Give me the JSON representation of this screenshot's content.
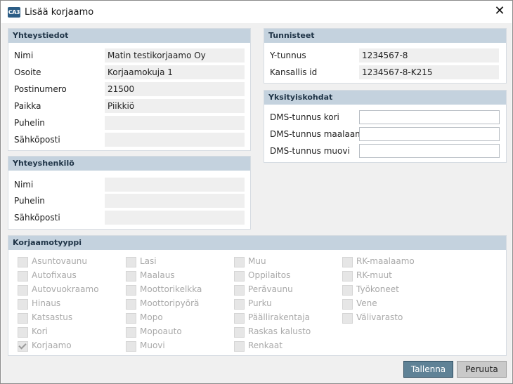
{
  "window": {
    "title": "Lisää korjaamo",
    "icon_text": "CA3",
    "close_glyph": "✕"
  },
  "contact": {
    "header": "Yhteystiedot",
    "fields": [
      {
        "label": "Nimi",
        "value": "Matin testikorjaamo Oy"
      },
      {
        "label": "Osoite",
        "value": "Korjaamokuja 1"
      },
      {
        "label": "Postinumero",
        "value": "21500"
      },
      {
        "label": "Paikka",
        "value": "Piikkiö"
      },
      {
        "label": "Puhelin",
        "value": ""
      },
      {
        "label": "Sähköposti",
        "value": ""
      }
    ]
  },
  "contact_person": {
    "header": "Yhteyshenkilö",
    "fields": [
      {
        "label": "Nimi",
        "value": ""
      },
      {
        "label": "Puhelin",
        "value": ""
      },
      {
        "label": "Sähköposti",
        "value": ""
      }
    ]
  },
  "identifiers": {
    "header": "Tunnisteet",
    "fields": [
      {
        "label": "Y-tunnus",
        "value": "1234567-8"
      },
      {
        "label": "Kansallis id",
        "value": "1234567-8-K215"
      }
    ]
  },
  "details": {
    "header": "Yksityiskohdat",
    "fields": [
      {
        "label": "DMS-tunnus kori",
        "value": ""
      },
      {
        "label": "DMS-tunnus maalaamo",
        "value": ""
      },
      {
        "label": "DMS-tunnus muovi",
        "value": ""
      }
    ]
  },
  "repair_types": {
    "header": "Korjaamotyyppi",
    "columns": [
      [
        {
          "label": "Asuntovaunu",
          "checked": false
        },
        {
          "label": "Autofixaus",
          "checked": false
        },
        {
          "label": "Autovuokraamo",
          "checked": false
        },
        {
          "label": "Hinaus",
          "checked": false
        },
        {
          "label": "Katsastus",
          "checked": false
        },
        {
          "label": "Kori",
          "checked": false
        },
        {
          "label": "Korjaamo",
          "checked": true
        }
      ],
      [
        {
          "label": "Lasi",
          "checked": false
        },
        {
          "label": "Maalaus",
          "checked": false
        },
        {
          "label": "Moottorikelkka",
          "checked": false
        },
        {
          "label": "Moottoripyörä",
          "checked": false
        },
        {
          "label": "Mopo",
          "checked": false
        },
        {
          "label": "Mopoauto",
          "checked": false
        },
        {
          "label": "Muovi",
          "checked": false
        }
      ],
      [
        {
          "label": "Muu",
          "checked": false
        },
        {
          "label": "Oppilaitos",
          "checked": false
        },
        {
          "label": "Perävaunu",
          "checked": false
        },
        {
          "label": "Purku",
          "checked": false
        },
        {
          "label": "Päällirakentaja",
          "checked": false
        },
        {
          "label": "Raskas kalusto",
          "checked": false
        },
        {
          "label": "Renkaat",
          "checked": false
        }
      ],
      [
        {
          "label": "RK-maalaamo",
          "checked": false
        },
        {
          "label": "RK-muut",
          "checked": false
        },
        {
          "label": "Työkoneet",
          "checked": false
        },
        {
          "label": "Vene",
          "checked": false
        },
        {
          "label": "Välivarasto",
          "checked": false
        }
      ]
    ]
  },
  "actions": {
    "save": "Tallenna",
    "cancel": "Peruuta"
  },
  "colors": {
    "header_bg": "#c4d2de",
    "primary": "#5f8296",
    "disabled_text": "#a9a9a9"
  }
}
